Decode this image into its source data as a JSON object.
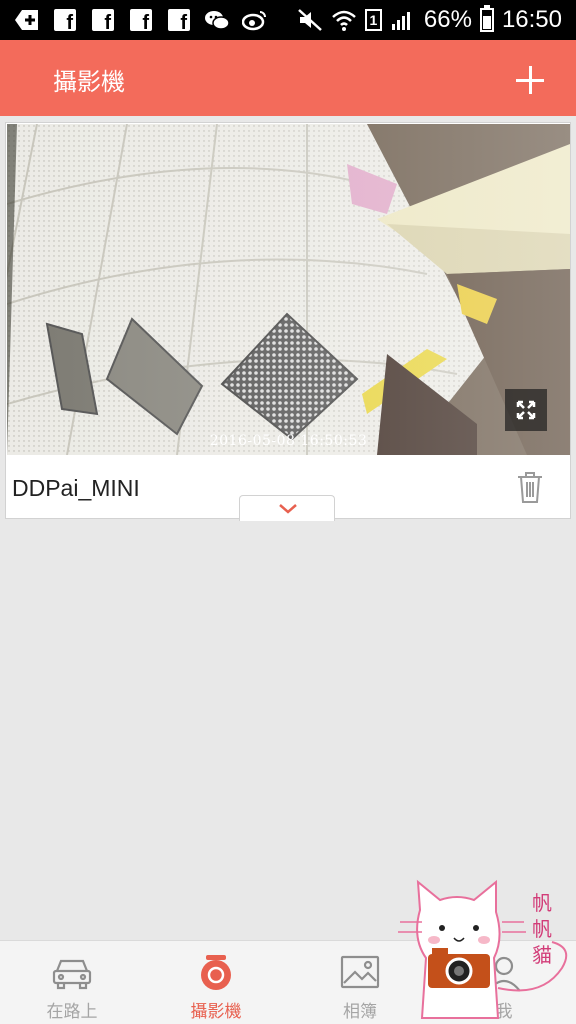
{
  "status_bar": {
    "left_icons": [
      "download-icon",
      "facebook-icon",
      "facebook-icon",
      "facebook-icon",
      "facebook-icon",
      "wechat-icon",
      "weibo-icon"
    ],
    "sim": "1",
    "battery_percent": "66%",
    "battery_level": 0.66,
    "time": "16:50"
  },
  "header": {
    "title": "攝影機",
    "add_icon": "plus-icon"
  },
  "camera_card": {
    "timestamp": "2016-05-08 16:50:53",
    "device_name": "DDPai_MINI",
    "fullscreen_icon": "fullscreen-icon",
    "delete_icon": "trash-icon",
    "expand_icon": "chevron-down-icon"
  },
  "bottom_nav": {
    "items": [
      {
        "label": "在路上",
        "icon": "car-icon"
      },
      {
        "label": "攝影機",
        "icon": "camera-icon"
      },
      {
        "label": "相簿",
        "icon": "image-icon"
      },
      {
        "label": "我",
        "icon": "person-icon"
      }
    ],
    "active": "攝影機"
  },
  "watermark": {
    "text": "帆帆貓"
  },
  "colors": {
    "accent": "#f36b5b",
    "status_bar": "#000000",
    "background": "#e8e8e8",
    "nav_inactive": "#a5a5a5"
  }
}
